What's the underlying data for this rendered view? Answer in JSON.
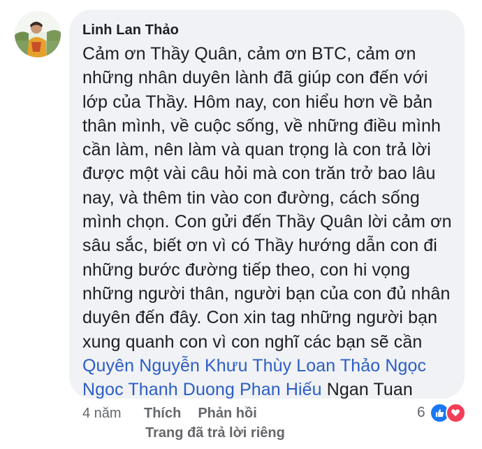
{
  "comment": {
    "author": "Linh Lan Thảo",
    "text_lines": [
      "Cảm ơn Thầy Quân, cảm ơn BTC, cảm ơn",
      "những nhân duyên lành đã giúp con đến với",
      "lớp của Thầy. Hôm nay, con hiểu hơn về bản",
      "thân mình, về cuộc sống, về những điều mình",
      "cần làm, nên làm và quan trọng là con trả lời",
      "được một vài câu hỏi mà con trăn trở bao lâu",
      "nay, và thêm tin vào con đường, cách sống",
      "mình chọn. Con gửi đến Thầy Quân lời cảm ơn",
      "sâu sắc, biết ơn vì có Thầy hướng dẫn con đi",
      "những bước đường tiếp theo, con hi vọng",
      "những người thân, người bạn của con đủ nhân",
      "duyên đến đây. Con xin tag những người bạn",
      "xung quanh con vì con nghĩ các bạn sẽ cần"
    ],
    "tags_line1": [
      "Quyên Nguyễn",
      "Khưu Thùy Loan",
      "Thảo Ngọc"
    ],
    "tags_line2": [
      "Ngoc Thanh Duong",
      "Phan Hiếu"
    ],
    "untagged_name": "Ngan Tuan"
  },
  "actions": {
    "time": "4 năm",
    "like_label": "Thích",
    "reply_label": "Phản hồi",
    "private_reply_note": "Trang đã trả lời riêng"
  },
  "reactions": {
    "count": "6",
    "types": [
      "like-icon",
      "love-icon"
    ],
    "colors": {
      "like": "#1877f2",
      "love": "#f33e58",
      "tag_link": "#2c5ec4"
    }
  }
}
